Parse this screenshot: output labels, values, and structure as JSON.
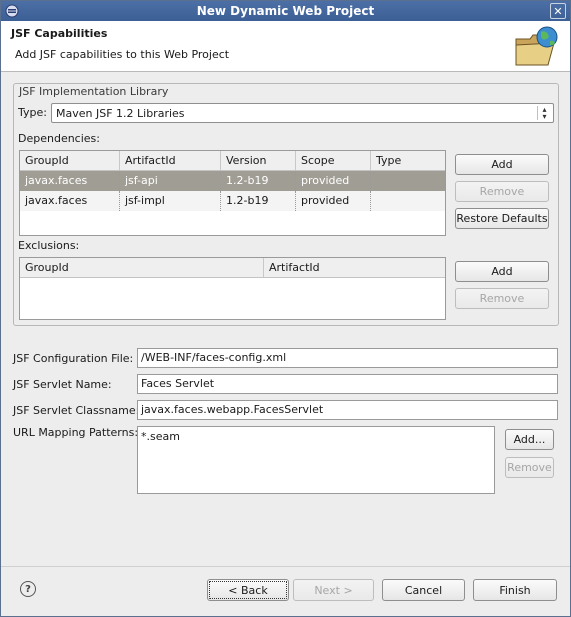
{
  "window": {
    "title": "New Dynamic Web Project",
    "close_symbol": "✕"
  },
  "header": {
    "title": "JSF Capabilities",
    "description": "Add JSF capabilities to this Web Project"
  },
  "impl_group": {
    "legend": "JSF Implementation Library",
    "type_label": "Type:",
    "type_value": "Maven JSF 1.2 Libraries",
    "dependencies_label": "Dependencies:",
    "dependencies": {
      "columns": [
        "GroupId",
        "ArtifactId",
        "Version",
        "Scope",
        "Type"
      ],
      "rows": [
        [
          "javax.faces",
          "jsf-api",
          "1.2-b19",
          "provided",
          ""
        ],
        [
          "javax.faces",
          "jsf-impl",
          "1.2-b19",
          "provided",
          ""
        ]
      ],
      "selected_row": 0
    },
    "dep_buttons": {
      "add": "Add",
      "remove": "Remove",
      "restore": "Restore Defaults"
    },
    "exclusions_label": "Exclusions:",
    "exclusions": {
      "columns": [
        "GroupId",
        "ArtifactId"
      ],
      "rows": []
    },
    "exc_buttons": {
      "add": "Add",
      "remove": "Remove"
    }
  },
  "config": {
    "config_file_label": "JSF Configuration File:",
    "config_file_value": "/WEB-INF/faces-config.xml",
    "servlet_name_label": "JSF Servlet Name:",
    "servlet_name_value": "Faces Servlet",
    "servlet_class_label": "JSF Servlet Classname:",
    "servlet_class_value": "javax.faces.webapp.FacesServlet",
    "url_patterns_label": "URL Mapping Patterns:",
    "url_patterns": [
      "*.seam"
    ],
    "add_button": "Add...",
    "remove_button": "Remove"
  },
  "footer": {
    "help_symbol": "?",
    "back": "< Back",
    "next": "Next >",
    "cancel": "Cancel",
    "finish": "Finish"
  },
  "colors": {
    "titlebar": "#4c6fa6",
    "selected_row": "#a09d94",
    "dialog_bg": "#ededed"
  },
  "icons": {
    "title_icon": "eclipse-window-icon",
    "header_art": "web-project-folder-globe-icon",
    "help": "help-icon",
    "combo": "combo-updown-icon"
  }
}
